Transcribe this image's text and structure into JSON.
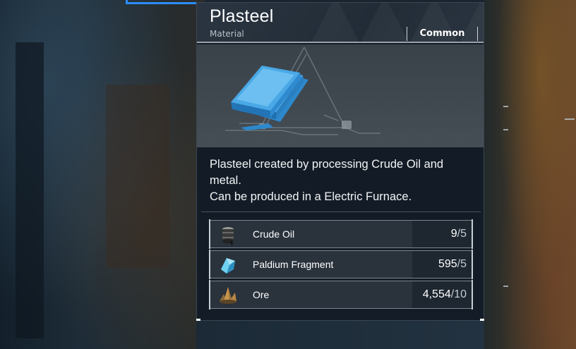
{
  "item": {
    "name": "Plasteel",
    "category": "Material",
    "rarity": "Common",
    "description_lines": [
      "Plasteel created by processing Crude Oil and",
      "metal.",
      "Can be produced in a Electric Furnace."
    ]
  },
  "recipe": [
    {
      "name": "Crude Oil",
      "have": "9",
      "need": "/5",
      "icon": "crude-oil-icon"
    },
    {
      "name": "Paldium Fragment",
      "have": "595",
      "need": "/5",
      "icon": "paldium-fragment-icon"
    },
    {
      "name": "Ore",
      "have": "4,554",
      "need": "/10",
      "icon": "ore-icon"
    }
  ],
  "colors": {
    "plasteel_blue": "#3fa3e6",
    "paldium_cyan": "#7fd6f0",
    "ore_gold": "#b98a45",
    "oil_dark": "#2a2a2a"
  }
}
